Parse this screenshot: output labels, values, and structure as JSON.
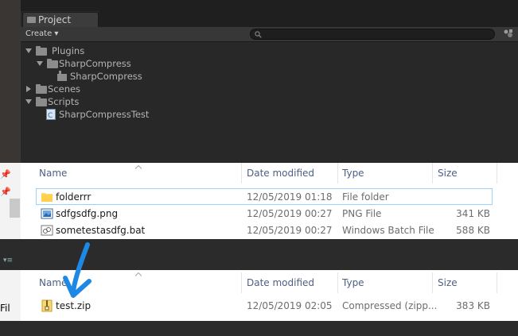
{
  "unity": {
    "project_tab": "Project",
    "create_label": "Create ▾",
    "tree": [
      {
        "label": "Plugins",
        "indent": 0,
        "expanded": true,
        "icon": "folder-icon"
      },
      {
        "label": "SharpCompress",
        "indent": 1,
        "expanded": true,
        "icon": "folder-icon"
      },
      {
        "label": "SharpCompress",
        "indent": 2,
        "expanded": null,
        "icon": "plugin-icon"
      },
      {
        "label": "Scenes",
        "indent": 0,
        "expanded": false,
        "icon": "folder-icon"
      },
      {
        "label": "Scripts",
        "indent": 0,
        "expanded": true,
        "icon": "folder-icon"
      },
      {
        "label": "SharpCompressTest",
        "indent": 1,
        "expanded": null,
        "icon": "csharp-script-icon"
      }
    ]
  },
  "explorer": {
    "columns": {
      "name": "Name",
      "date": "Date modified",
      "type": "Type",
      "size": "Size"
    },
    "top_files": [
      {
        "name": "folderrr",
        "date": "12/05/2019 01:18",
        "type": "File folder",
        "size": "",
        "icon": "folder-icon",
        "selected": true
      },
      {
        "name": "sdfgsdfg.png",
        "date": "12/05/2019 00:27",
        "type": "PNG File",
        "size": "341 KB",
        "icon": "image-file-icon",
        "selected": false
      },
      {
        "name": "sometestasdfg.bat",
        "date": "12/05/2019 00:27",
        "type": "Windows Batch File",
        "size": "588 KB",
        "icon": "batch-file-icon",
        "selected": false
      }
    ],
    "bottom_files": [
      {
        "name": "test.zip",
        "date": "12/05/2019 02:05",
        "type": "Compressed (zipp...",
        "size": "383 KB",
        "icon": "zip-file-icon"
      }
    ],
    "side_label": "Fil"
  },
  "colors": {
    "selection_border": "#99d1ff",
    "header_text": "#4d6082",
    "arrow": "#1e88e5"
  }
}
